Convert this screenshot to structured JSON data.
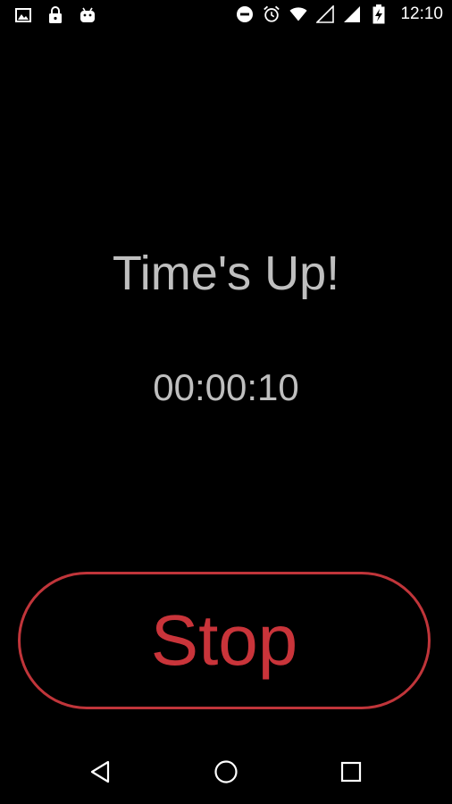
{
  "status_bar": {
    "left_icons": [
      "image-icon",
      "lock-icon",
      "android-icon"
    ],
    "right_icons": [
      "do-not-disturb-icon",
      "alarm-icon",
      "wifi-icon",
      "signal-icon",
      "signal-full-icon",
      "battery-charging-icon"
    ],
    "clock": "12:10"
  },
  "main": {
    "title": "Time's Up!",
    "time": "00:00:10",
    "stop_label": "Stop"
  },
  "nav_bar": {
    "icons": [
      "back-icon",
      "home-icon",
      "recents-icon"
    ]
  },
  "colors": {
    "background": "#000000",
    "text": "#bfbfbf",
    "accent": "#c9343a"
  }
}
